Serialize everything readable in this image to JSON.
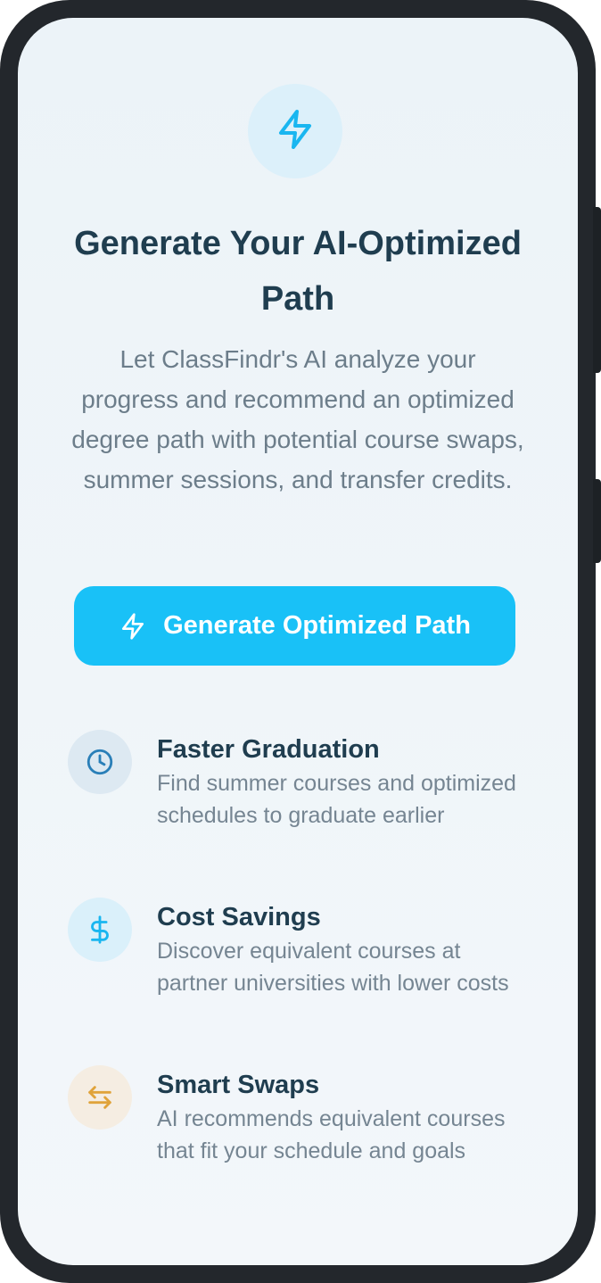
{
  "hero": {
    "icon": "lightning-bolt-icon",
    "icon_color": "#19b6f0"
  },
  "title": "Generate Your AI-Optimized Path",
  "description": "Let ClassFindr's AI analyze your progress and recommend an optimized degree path with potential course swaps, summer sessions, and transfer credits.",
  "cta": {
    "label": "Generate Optimized Path",
    "icon": "lightning-bolt-icon",
    "color": "#19c1f7"
  },
  "features": [
    {
      "icon": "clock-icon",
      "icon_color": "#2a7fb8",
      "title": "Faster Graduation",
      "description": "Find summer courses and optimized schedules to graduate earlier"
    },
    {
      "icon": "dollar-icon",
      "icon_color": "#19b6f0",
      "title": "Cost Savings",
      "description": "Discover equivalent courses at partner universities with lower costs"
    },
    {
      "icon": "swap-arrows-icon",
      "icon_color": "#e0a33a",
      "title": "Smart Swaps",
      "description": "AI recommends equivalent courses that fit your schedule and goals"
    }
  ]
}
